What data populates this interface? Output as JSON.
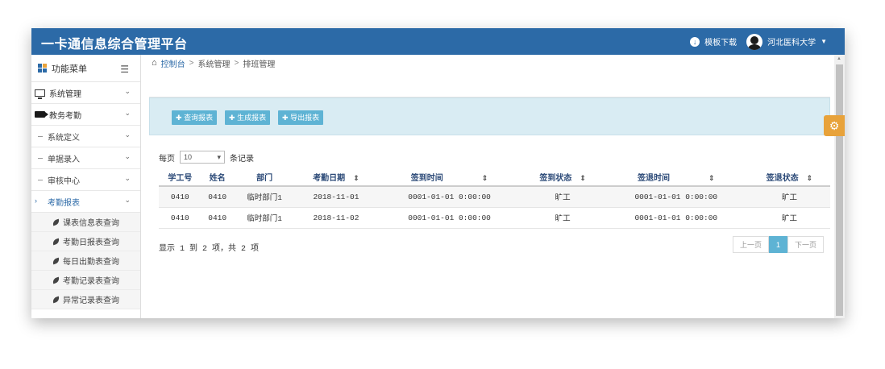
{
  "topbar": {
    "title": "一卡通信息综合管理平台",
    "template_download": "模板下载",
    "user": "河北医科大学"
  },
  "sidebar": {
    "header": "功能菜单",
    "items": [
      {
        "label": "系统管理"
      },
      {
        "label": "教务考勤"
      }
    ],
    "subs": [
      {
        "label": "系统定义"
      },
      {
        "label": "单据录入"
      },
      {
        "label": "审核中心"
      },
      {
        "label": "考勤报表"
      }
    ],
    "leaves": [
      {
        "label": "课表信息表查询"
      },
      {
        "label": "考勤日报表查询"
      },
      {
        "label": "每日出勤表查询"
      },
      {
        "label": "考勤记录表查询"
      },
      {
        "label": "异常记录表查询"
      }
    ]
  },
  "breadcrumb": {
    "home": "控制台",
    "level1": "系统管理",
    "level2": "排班管理"
  },
  "toolbar": {
    "query": "查询报表",
    "generate": "生成报表",
    "export": "导出报表"
  },
  "pager": {
    "prefix": "每页",
    "size": "10",
    "suffix": "条记录"
  },
  "table": {
    "headers": [
      "学工号",
      "姓名",
      "部门",
      "考勤日期",
      "签到时间",
      "签到状态",
      "签退时间",
      "签退状态"
    ],
    "rows": [
      [
        "0410",
        "0410",
        "临时部门1",
        "2018-11-01",
        "0001-01-01 0:00:00",
        "旷工",
        "0001-01-01 0:00:00",
        "旷工"
      ],
      [
        "0410",
        "0410",
        "临时部门1",
        "2018-11-02",
        "0001-01-01 0:00:00",
        "旷工",
        "0001-01-01 0:00:00",
        "旷工"
      ]
    ]
  },
  "summary": "显示 1 到 2 项，共 2 项",
  "pagination": {
    "prev": "上一页",
    "current": "1",
    "next": "下一页"
  },
  "colors": {
    "topbar": "#2c6aa7",
    "button": "#5eb3d4",
    "toolbar_bg": "#d9ecf3",
    "accent": "#e8a23a"
  }
}
